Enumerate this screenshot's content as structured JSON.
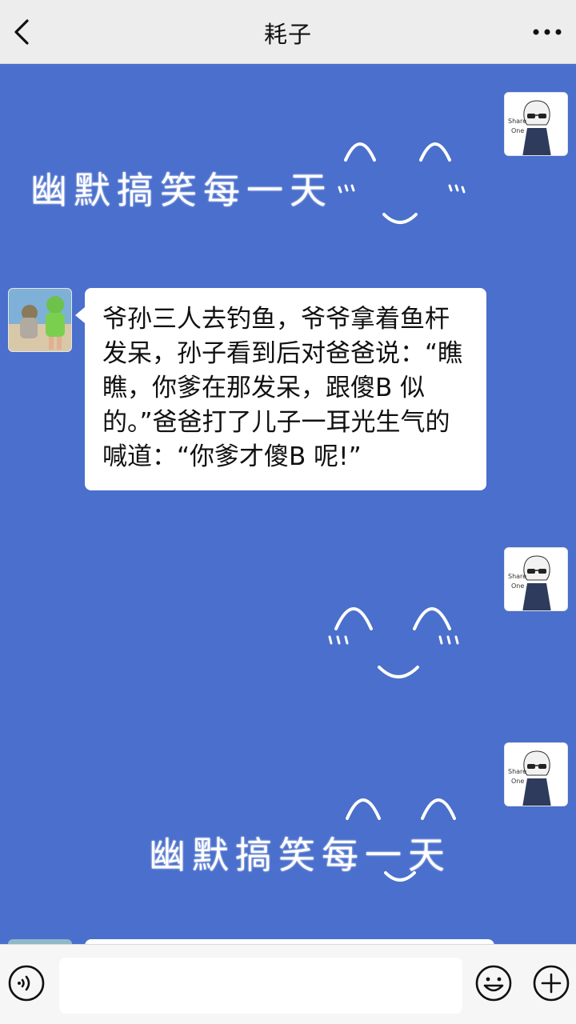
{
  "header": {
    "title": "耗子",
    "back_icon": "chevron-left-icon",
    "more_icon": "more-dots-icon"
  },
  "messages": {
    "sticker_1_text": "幽默搞笑每一天",
    "text_message": "爷孙三人去钓鱼，爷爷拿着鱼杆发呆，孙子看到后对爸爸说：“瞧瞧，你爹在那发呆，跟傻B 似的。”爸爸打了儿子一耳光生气的喊道：“你爹才傻B 呢!”",
    "sticker_3_text": "幽默搞笑每一天"
  },
  "avatars": {
    "self_avatar_text": "Share One"
  },
  "input_bar": {
    "voice_icon": "voice-icon",
    "emoji_icon": "emoji-icon",
    "plus_icon": "plus-icon"
  },
  "colors": {
    "chat_background": "#4a6fcc",
    "bubble": "#ffffff",
    "top_bar": "#ededed"
  }
}
